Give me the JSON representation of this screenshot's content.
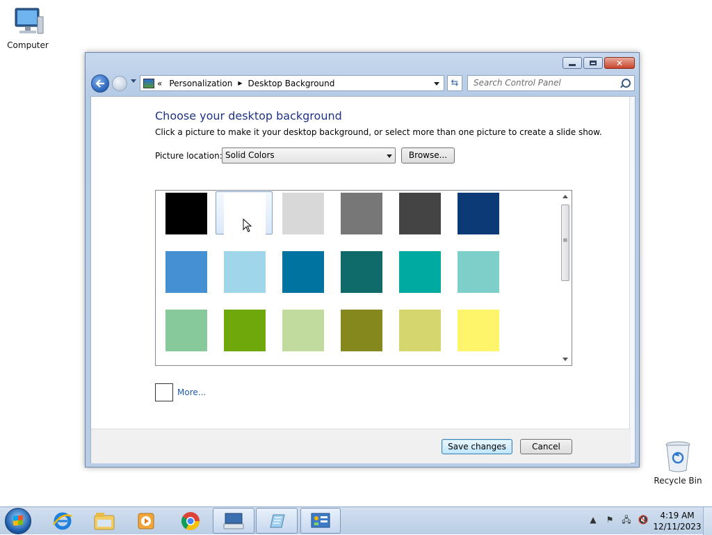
{
  "desktop": {
    "icons": [
      {
        "label": "Computer",
        "icon": "computer-icon"
      },
      {
        "label": "Recycle Bin",
        "icon": "recycle-bin-icon"
      }
    ]
  },
  "window": {
    "address": {
      "overflow": "«",
      "breadcrumbs": [
        "Personalization",
        "Desktop Background"
      ]
    },
    "search": {
      "placeholder": "Search Control Panel"
    },
    "heading": "Choose your desktop background",
    "description": "Click a picture to make it your desktop background, or select more than one picture to create a slide show.",
    "picture_location": {
      "label": "Picture location:",
      "value": "Solid Colors"
    },
    "browse_label": "Browse...",
    "swatches": [
      "#000000",
      "#ffffff",
      "#d8d8d8",
      "#777777",
      "#444444",
      "#0c3a76",
      "#4590d2",
      "#9fd6ea",
      "#0073a0",
      "#0f6a6a",
      "#00aaa0",
      "#7ecfca",
      "#87c99a",
      "#6fa80a",
      "#c1db9e",
      "#85881c",
      "#d6d66e",
      "#fff56a"
    ],
    "hovered_swatch": 1,
    "more_label": "More...",
    "save_label": "Save changes",
    "cancel_label": "Cancel"
  },
  "taskbar": {
    "pinned": [
      "internet-explorer-icon",
      "windows-explorer-icon",
      "media-player-icon",
      "chrome-icon",
      "keyboard-app-icon",
      "notepad-icon",
      "control-panel-icon"
    ],
    "tray": [
      "show-hidden-icons",
      "action-center-icon",
      "network-icon",
      "volume-muted-icon"
    ],
    "time": "4:19 AM",
    "date": "12/11/2023"
  }
}
